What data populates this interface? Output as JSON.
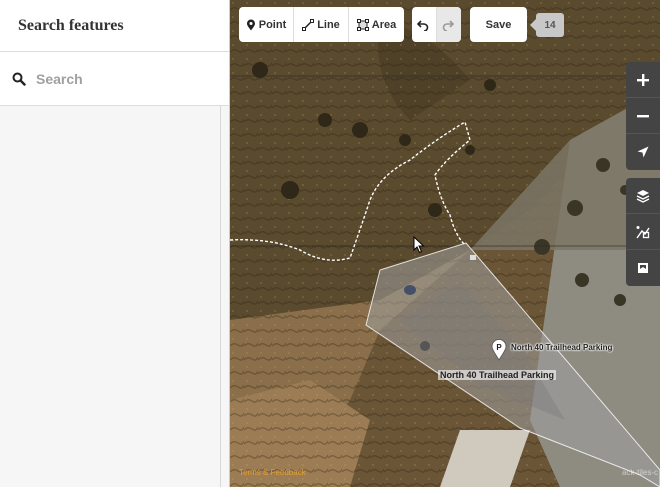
{
  "sidebar": {
    "title": "Search features",
    "search": {
      "placeholder": "Search",
      "value": ""
    }
  },
  "toolbar": {
    "point_label": "Point",
    "line_label": "Line",
    "area_label": "Area",
    "save_label": "Save",
    "edit_count": "14"
  },
  "map": {
    "poi_label": "North 40 Trailhead Parking",
    "area_label": "North 40 Trailhead Parking",
    "poi_marker_letter": "P",
    "attribution": "Terms & Feedback",
    "tiles_credit": "ack-tiles-c"
  },
  "controls": {
    "zoom_in_icon": "plus-icon",
    "zoom_out_icon": "minus-icon",
    "geolocate_icon": "location-arrow-icon",
    "background_icon": "layers-icon",
    "map_data_icon": "map-data-icon",
    "issues_icon": "help-icon"
  },
  "colors": {
    "accent": "#e0a030",
    "control_bg": "#444444",
    "area_fill": "#9a9a9a"
  }
}
